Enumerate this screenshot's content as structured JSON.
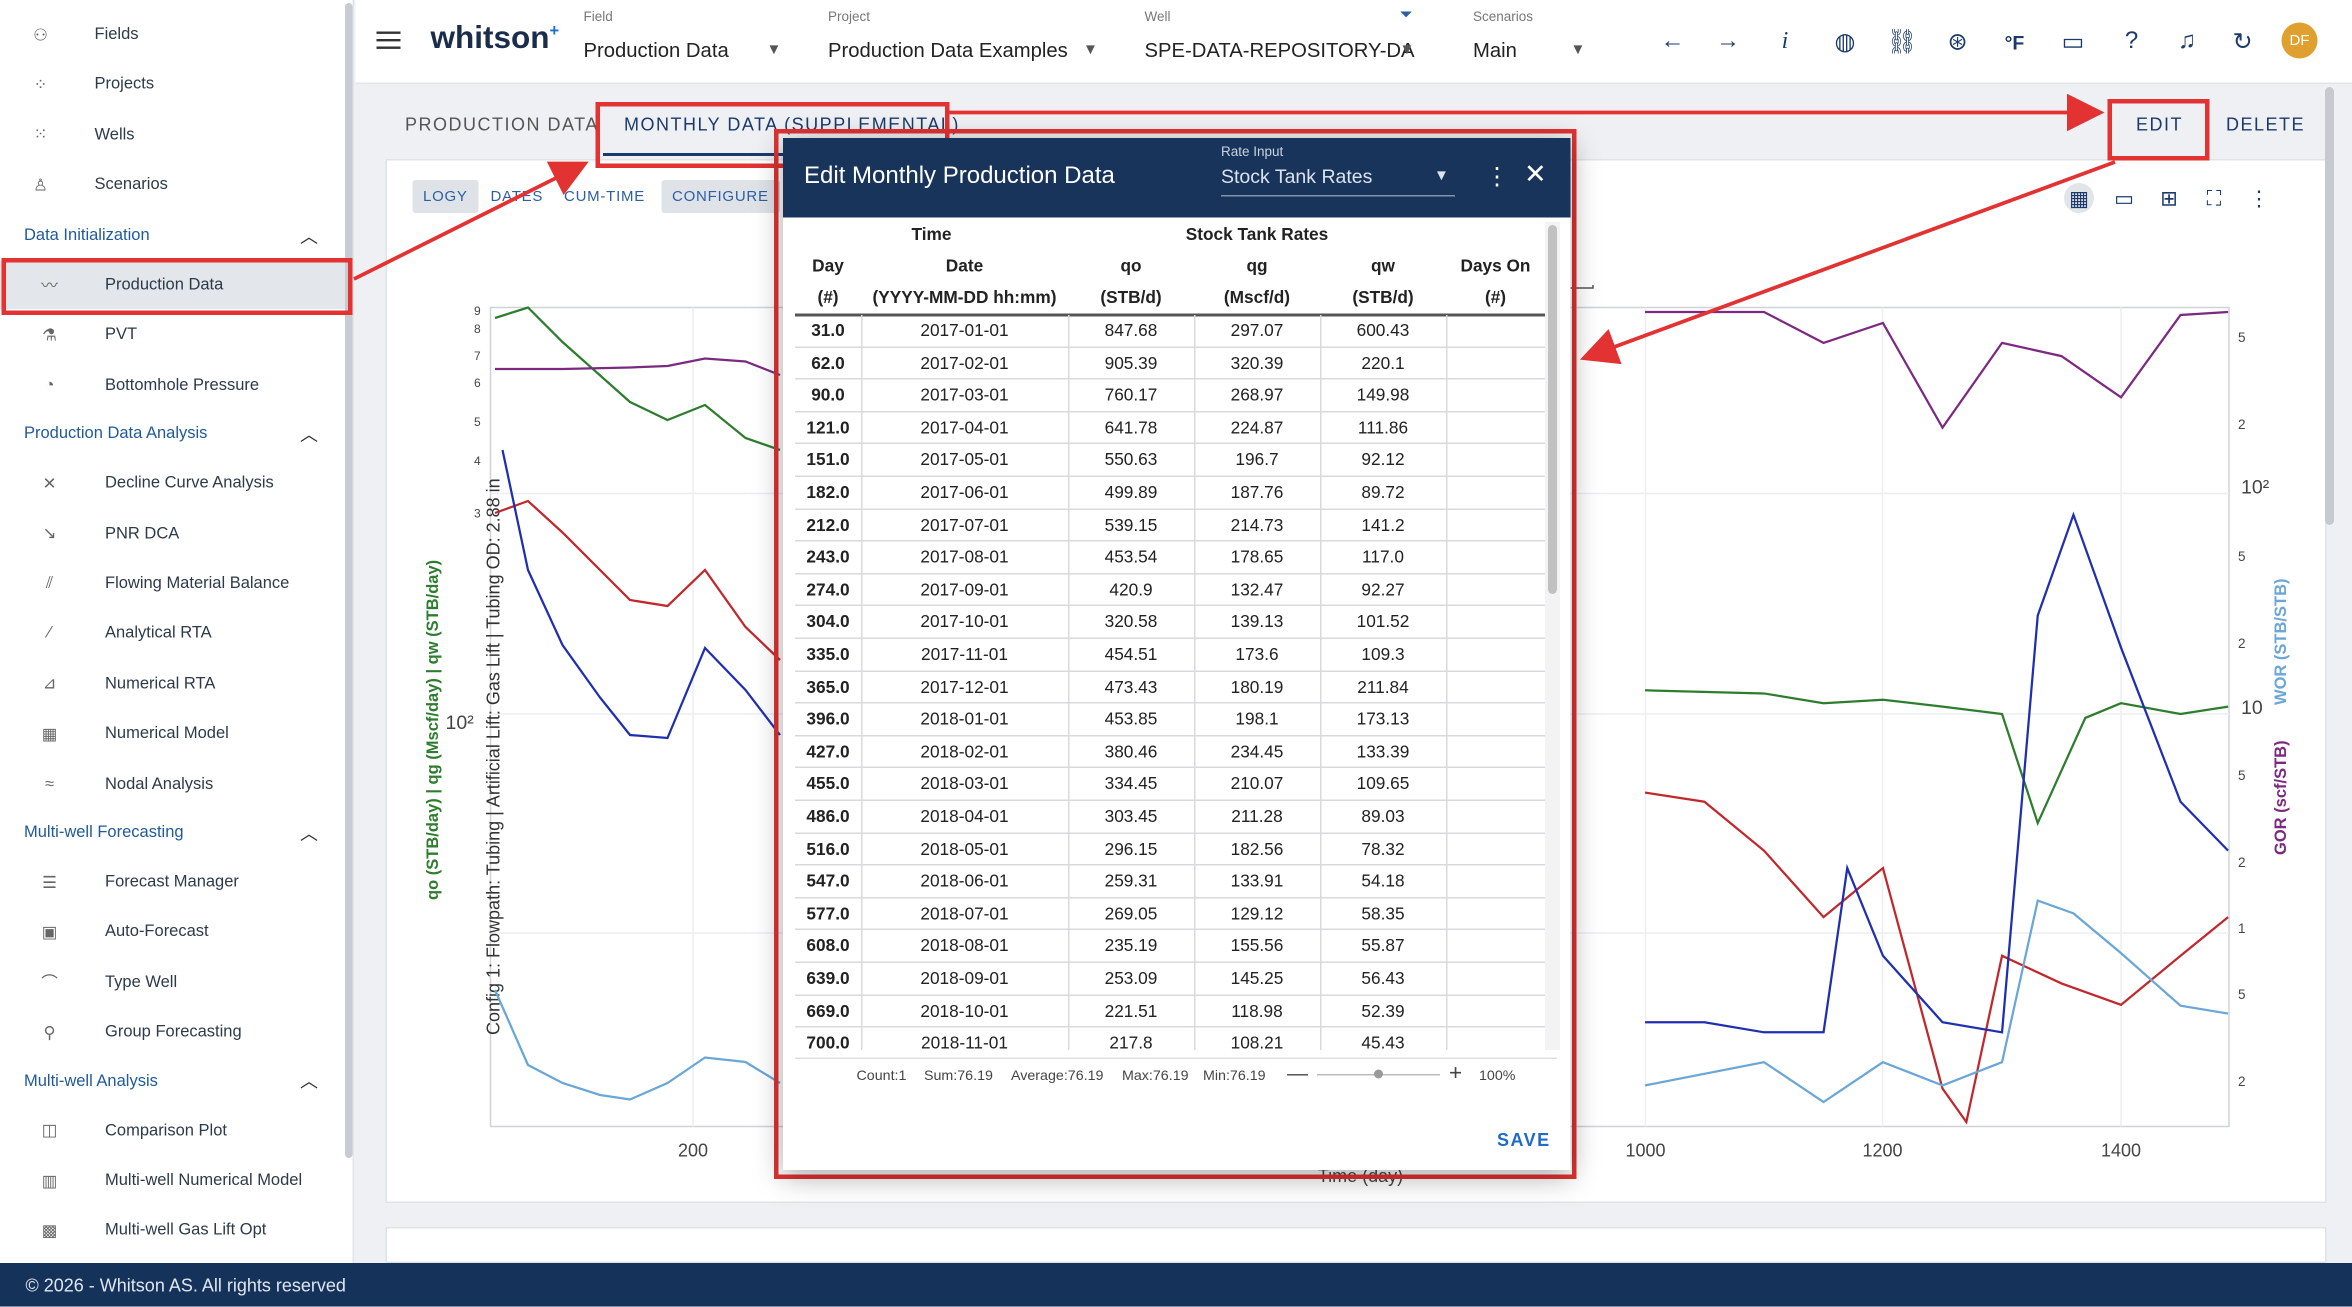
{
  "sidebar": {
    "top_items": [
      {
        "label": "Fields",
        "icon": "fields-icon"
      },
      {
        "label": "Projects",
        "icon": "projects-icon"
      },
      {
        "label": "Wells",
        "icon": "wells-icon"
      },
      {
        "label": "Scenarios",
        "icon": "scenarios-icon"
      }
    ],
    "sections": [
      {
        "title": "Data Initialization",
        "items": [
          {
            "label": "Production Data",
            "icon": "production-data-icon"
          },
          {
            "label": "PVT",
            "icon": "pvt-icon"
          },
          {
            "label": "Bottomhole Pressure",
            "icon": "bottomhole-pressure-icon"
          }
        ]
      },
      {
        "title": "Production Data Analysis",
        "items": [
          {
            "label": "Decline Curve Analysis",
            "icon": "dca-icon"
          },
          {
            "label": "PNR DCA",
            "icon": "pnr-dca-icon"
          },
          {
            "label": "Flowing Material Balance",
            "icon": "fmb-icon"
          },
          {
            "label": "Analytical RTA",
            "icon": "analytical-rta-icon"
          },
          {
            "label": "Numerical RTA",
            "icon": "numerical-rta-icon"
          },
          {
            "label": "Numerical Model",
            "icon": "numerical-model-icon"
          },
          {
            "label": "Nodal Analysis",
            "icon": "nodal-analysis-icon"
          }
        ]
      },
      {
        "title": "Multi-well Forecasting",
        "items": [
          {
            "label": "Forecast Manager",
            "icon": "forecast-manager-icon"
          },
          {
            "label": "Auto-Forecast",
            "icon": "auto-forecast-icon"
          },
          {
            "label": "Type Well",
            "icon": "type-well-icon"
          },
          {
            "label": "Group Forecasting",
            "icon": "group-forecasting-icon"
          }
        ]
      },
      {
        "title": "Multi-well Analysis",
        "items": [
          {
            "label": "Comparison Plot",
            "icon": "comparison-plot-icon"
          },
          {
            "label": "Multi-well Numerical Model",
            "icon": "multiwell-numerical-model-icon"
          },
          {
            "label": "Multi-well Gas Lift Opt",
            "icon": "multiwell-gas-lift-icon"
          }
        ]
      }
    ]
  },
  "topbar": {
    "logo": "whitson",
    "logo_sup": "+",
    "field": {
      "caption": "Field",
      "value": "Production Data"
    },
    "project": {
      "caption": "Project",
      "value": "Production Data Examples"
    },
    "well": {
      "caption": "Well",
      "value": "SPE-DATA-REPOSITORY-DA"
    },
    "scenarios": {
      "caption": "Scenarios",
      "value": "Main"
    },
    "units_label": "°F",
    "info_label": "i",
    "avatar": "DF"
  },
  "tabs": {
    "production_data": "PRODUCTION DATA",
    "monthly_data": "MONTHLY DATA (SUPPLEMENTAL)",
    "edit": "EDIT",
    "delete": "DELETE"
  },
  "chart_toolbar": {
    "logy": "LOGY",
    "dates": "DATES",
    "cum_time": "CUM-TIME",
    "configure": "CONFIGURE"
  },
  "chart": {
    "left_axis_label": "qo (STB/day) | qg (Mscf/day) | qw (STB/day)",
    "rotated_info": "Config 1: Flowpath: Tubing | Artificial Lift: Gas Lift | Tubing OD: 2.88 in",
    "right_axis_label_gor": "GOR (scf/STB)",
    "right_axis_label_wor": "WOR (STB/STB)",
    "x_axis_label": "Time (day)",
    "x_ticks": [
      "200",
      "1000",
      "1200",
      "1400"
    ],
    "left_tick_10e2": "10²",
    "right_ticks": [
      "5",
      "2",
      "10²",
      "5",
      "2",
      "10",
      "5",
      "2",
      "1",
      "5",
      "2"
    ],
    "colors": {
      "qo": "#2e7d2e",
      "qg": "#c0282d",
      "qw": "#1f2fb0",
      "gor": "#7b2a80",
      "wor": "#6aa7d6"
    }
  },
  "chart_data": {
    "type": "line",
    "xlabel": "Time (day)",
    "ylabel": "qo (STB/day) | qg (Mscf/day) | qw (STB/day)",
    "y_scale": "log",
    "series": [
      {
        "name": "qo",
        "x": [
          1000,
          1100,
          1150,
          1200,
          1250,
          1300,
          1330,
          1370,
          1400,
          1450,
          1490
        ],
        "y": [
          32,
          31,
          28,
          29,
          27,
          25,
          8,
          24,
          28,
          25,
          27
        ]
      },
      {
        "name": "qg",
        "x": [
          1000,
          1050,
          1100,
          1150,
          1200,
          1250,
          1270,
          1300,
          1350,
          1400,
          1450,
          1490
        ],
        "y": [
          11,
          10,
          6,
          3,
          5,
          0.5,
          0.3,
          2,
          1.5,
          1.2,
          2,
          3
        ]
      },
      {
        "name": "qw",
        "x": [
          1000,
          1050,
          1100,
          1150,
          1170,
          1200,
          1250,
          1300,
          1330,
          1360,
          1400,
          1450,
          1490
        ],
        "y": [
          1,
          1,
          0.9,
          0.9,
          5,
          2,
          1,
          0.9,
          70,
          200,
          50,
          10,
          6
        ]
      },
      {
        "name": "GOR",
        "x": [
          1000,
          1100,
          1150,
          1200,
          1250,
          1300,
          1350,
          1400,
          1450,
          1490
        ],
        "y": [
          500,
          450,
          250,
          350,
          60,
          250,
          200,
          100,
          400,
          450
        ]
      },
      {
        "name": "WOR",
        "x": [
          1000,
          1100,
          1150,
          1200,
          1250,
          1300,
          1330,
          1360,
          1400,
          1450,
          1490
        ],
        "y": [
          0.2,
          0.3,
          0.15,
          0.3,
          0.2,
          0.3,
          5,
          4,
          2,
          0.8,
          0.7
        ]
      }
    ]
  },
  "modal": {
    "title": "Edit Monthly Production Data",
    "rate_input_caption": "Rate Input",
    "rate_input_value": "Stock Tank Rates",
    "header_group_time": "Time",
    "header_group_rates": "Stock Tank Rates",
    "headers": [
      "Day",
      "Date",
      "qo",
      "qg",
      "qw",
      "Days On"
    ],
    "units": [
      "(#)",
      "(YYYY-MM-DD hh:mm)",
      "(STB/d)",
      "(Mscf/d)",
      "(STB/d)",
      "(#)"
    ],
    "rows": [
      [
        "31.0",
        "2017-01-01",
        "847.68",
        "297.07",
        "600.43",
        ""
      ],
      [
        "62.0",
        "2017-02-01",
        "905.39",
        "320.39",
        "220.1",
        ""
      ],
      [
        "90.0",
        "2017-03-01",
        "760.17",
        "268.97",
        "149.98",
        ""
      ],
      [
        "121.0",
        "2017-04-01",
        "641.78",
        "224.87",
        "111.86",
        ""
      ],
      [
        "151.0",
        "2017-05-01",
        "550.63",
        "196.7",
        "92.12",
        ""
      ],
      [
        "182.0",
        "2017-06-01",
        "499.89",
        "187.76",
        "89.72",
        ""
      ],
      [
        "212.0",
        "2017-07-01",
        "539.15",
        "214.73",
        "141.2",
        ""
      ],
      [
        "243.0",
        "2017-08-01",
        "453.54",
        "178.65",
        "117.0",
        ""
      ],
      [
        "274.0",
        "2017-09-01",
        "420.9",
        "132.47",
        "92.27",
        ""
      ],
      [
        "304.0",
        "2017-10-01",
        "320.58",
        "139.13",
        "101.52",
        ""
      ],
      [
        "335.0",
        "2017-11-01",
        "454.51",
        "173.6",
        "109.3",
        ""
      ],
      [
        "365.0",
        "2017-12-01",
        "473.43",
        "180.19",
        "211.84",
        ""
      ],
      [
        "396.0",
        "2018-01-01",
        "453.85",
        "198.1",
        "173.13",
        ""
      ],
      [
        "427.0",
        "2018-02-01",
        "380.46",
        "234.45",
        "133.39",
        ""
      ],
      [
        "455.0",
        "2018-03-01",
        "334.45",
        "210.07",
        "109.65",
        ""
      ],
      [
        "486.0",
        "2018-04-01",
        "303.45",
        "211.28",
        "89.03",
        ""
      ],
      [
        "516.0",
        "2018-05-01",
        "296.15",
        "182.56",
        "78.32",
        ""
      ],
      [
        "547.0",
        "2018-06-01",
        "259.31",
        "133.91",
        "54.18",
        ""
      ],
      [
        "577.0",
        "2018-07-01",
        "269.05",
        "129.12",
        "58.35",
        ""
      ],
      [
        "608.0",
        "2018-08-01",
        "235.19",
        "155.56",
        "55.87",
        ""
      ],
      [
        "639.0",
        "2018-09-01",
        "253.09",
        "145.25",
        "56.43",
        ""
      ],
      [
        "669.0",
        "2018-10-01",
        "221.51",
        "118.98",
        "52.39",
        ""
      ],
      [
        "700.0",
        "2018-11-01",
        "217.8",
        "108.21",
        "45.43",
        ""
      ]
    ],
    "status": {
      "count": "Count:1",
      "sum": "Sum:76.19",
      "average": "Average:76.19",
      "max": "Max:76.19",
      "min": "Min:76.19",
      "zoom": "100%"
    },
    "save": "SAVE"
  },
  "footer": "© 2026 - Whitson AS. All rights reserved"
}
